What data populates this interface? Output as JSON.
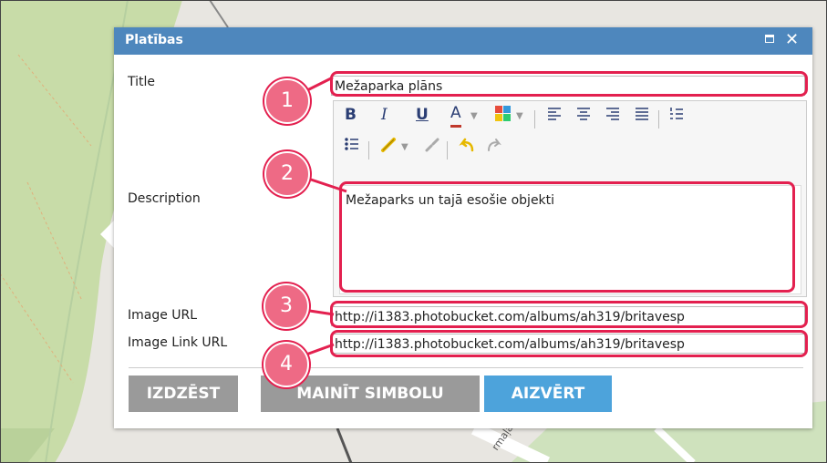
{
  "dialog": {
    "title": "Platības",
    "fields": {
      "title_label": "Title",
      "title_value": "Mežaparka plāns",
      "description_label": "Description",
      "description_value": "Mežaparks un tajā esošie objekti",
      "image_url_label": "Image URL",
      "image_url_value": "http://i1383.photobucket.com/albums/ah319/britavesp",
      "image_link_label": "Image Link URL",
      "image_link_value": "http://i1383.photobucket.com/albums/ah319/britavesp"
    },
    "toolbar": {
      "bold": "B",
      "italic": "I",
      "underline": "U",
      "font_color": "A"
    },
    "buttons": {
      "delete": "IZDZĒST",
      "change_symbol": "MAINĪT SIMBOLU",
      "close": "AIZVĒRT"
    }
  },
  "callouts": [
    "1",
    "2",
    "3",
    "4"
  ],
  "map": {
    "street_label": "rmaļa"
  },
  "colors": {
    "titlebar": "#4e87bd",
    "callout": "#e3204f",
    "badge": "#ee6a85",
    "button_gray": "#9a9a9a",
    "button_blue": "#4da3db",
    "park": "#c8dca8"
  }
}
